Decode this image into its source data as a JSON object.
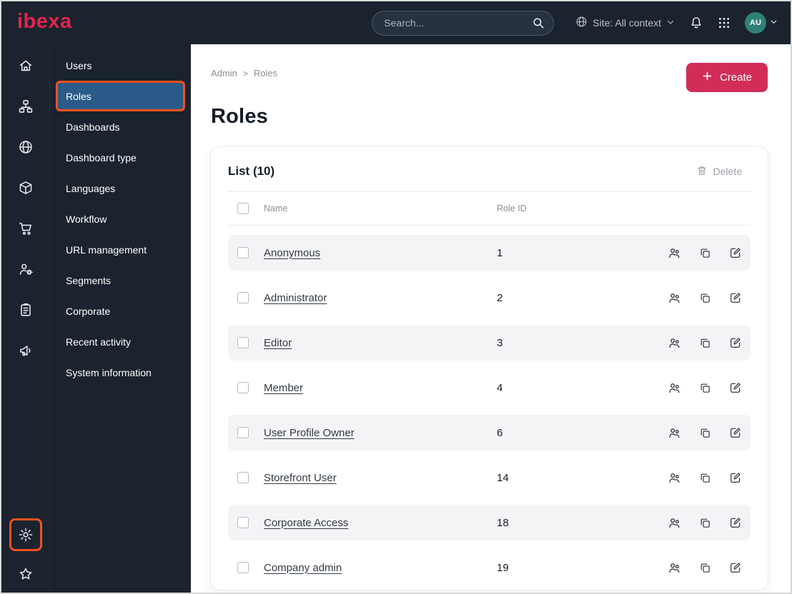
{
  "colors": {
    "topbar_bg": "#1a232e",
    "brand_red": "#e2254a",
    "highlight_orange": "#f4511e",
    "active_menu_blue": "#2a5a8a",
    "create_button_red": "#d22d59",
    "avatar_teal": "#2f8178",
    "row_stripe_gray": "#f4f4f6"
  },
  "topbar": {
    "logo": "ibexa",
    "search_placeholder": "Search...",
    "site_context": "Site: All context",
    "avatar_initials": "AU"
  },
  "icon_rail": {
    "items": [
      {
        "icon": "home"
      },
      {
        "icon": "content-tree"
      },
      {
        "icon": "site-globe"
      },
      {
        "icon": "products-box"
      },
      {
        "icon": "commerce-cart"
      },
      {
        "icon": "customers"
      },
      {
        "icon": "orders"
      },
      {
        "icon": "marketing-megaphone"
      }
    ],
    "bottom_items": [
      {
        "icon": "admin-gear",
        "highlighted": true
      },
      {
        "icon": "bookmarks-star"
      }
    ]
  },
  "sidebar": {
    "items": [
      {
        "label": "Users"
      },
      {
        "label": "Roles",
        "active": true
      },
      {
        "label": "Dashboards"
      },
      {
        "label": "Dashboard type"
      },
      {
        "label": "Languages"
      },
      {
        "label": "Workflow"
      },
      {
        "label": "URL management"
      },
      {
        "label": "Segments"
      },
      {
        "label": "Corporate"
      },
      {
        "label": "Recent activity"
      },
      {
        "label": "System information"
      }
    ]
  },
  "main": {
    "breadcrumb": {
      "items": [
        "Admin",
        "Roles"
      ],
      "separator": ">"
    },
    "create_label": "Create",
    "title": "Roles",
    "list": {
      "header": "List (10)",
      "delete_label": "Delete",
      "columns": [
        "Name",
        "Role ID"
      ],
      "rows": [
        {
          "name": "Anonymous",
          "role_id": "1"
        },
        {
          "name": "Administrator",
          "role_id": "2"
        },
        {
          "name": "Editor",
          "role_id": "3"
        },
        {
          "name": "Member",
          "role_id": "4"
        },
        {
          "name": "User Profile Owner",
          "role_id": "6"
        },
        {
          "name": "Storefront User",
          "role_id": "14"
        },
        {
          "name": "Corporate Access",
          "role_id": "18"
        },
        {
          "name": "Company admin",
          "role_id": "19"
        }
      ]
    }
  }
}
